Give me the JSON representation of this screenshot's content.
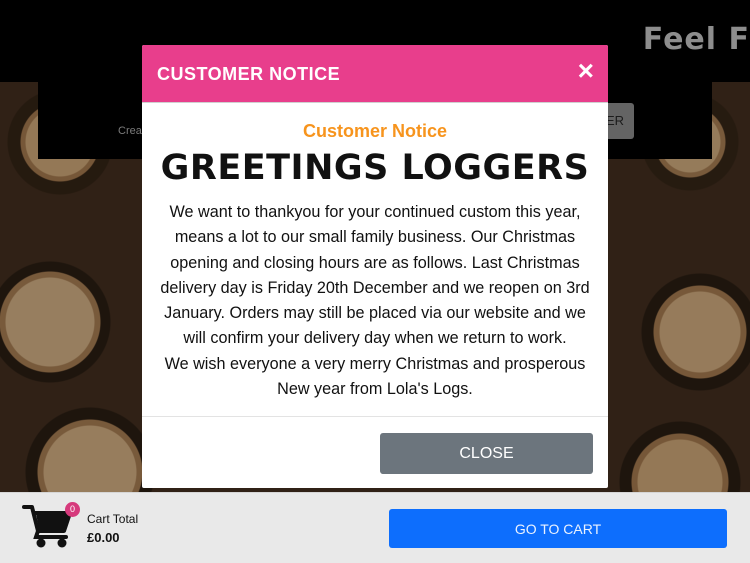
{
  "page": {
    "hero_title": "Feel F",
    "panel_text": "Crea",
    "panel_button": "ER"
  },
  "modal": {
    "title": "CUSTOMER NOTICE",
    "close_x": "×",
    "subheading": "Customer Notice",
    "heading": "GREETINGS LOGGERS",
    "paragraph1": "We want to thankyou for your continued custom this year, means a lot to our small family business. Our Christmas opening and closing hours are as follows. Last Christmas delivery day is Friday 20th December and we reopen on 3rd January. Orders may still be placed via our website and we will confirm your delivery day when we return to work.",
    "paragraph2": "We wish everyone a very merry Christmas and prosperous New year from Lola's Logs.",
    "close_button": "CLOSE"
  },
  "cart": {
    "count": "0",
    "total_label": "Cart Total",
    "total_value": "£0.00",
    "go_to_cart": "GO TO CART"
  },
  "colors": {
    "modal_header": "#e83e8c",
    "subheading": "#f7941d",
    "close_button": "#6c757d",
    "go_to_cart_button": "#0d6efd",
    "cart_badge": "#d63a7c"
  },
  "icons": {
    "cart": "shopping-cart-icon",
    "close": "close-icon"
  }
}
